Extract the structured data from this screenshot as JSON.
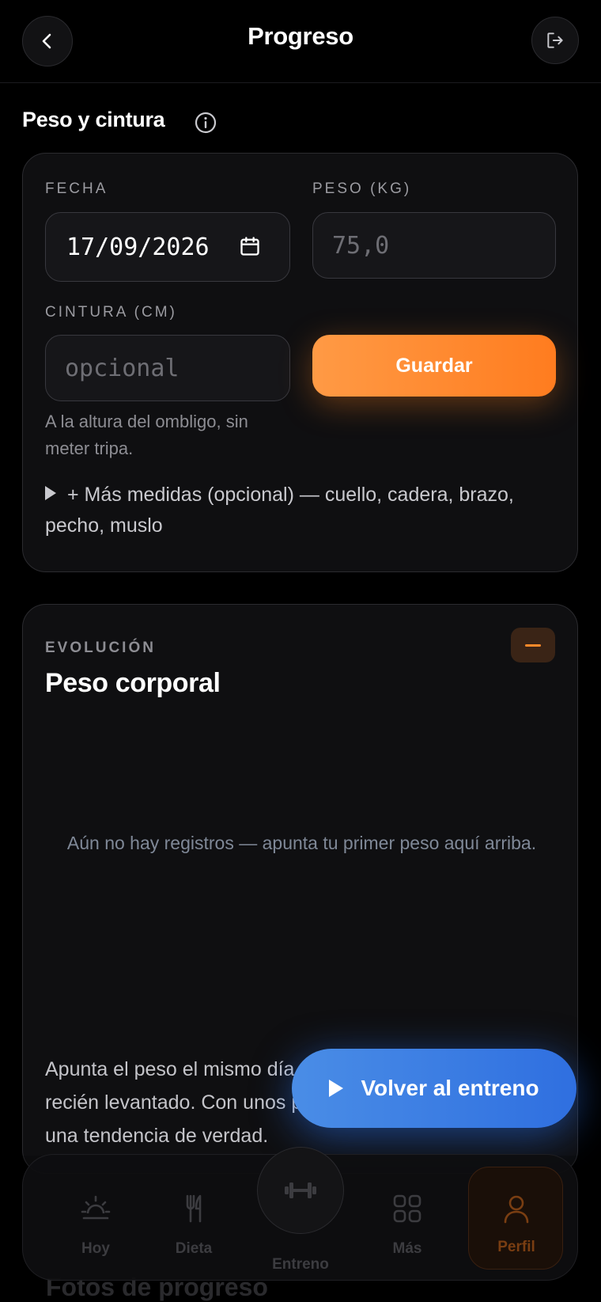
{
  "header": {
    "title": "Progreso",
    "back_icon": "chevron-left-icon",
    "logout_icon": "logout-icon"
  },
  "section": {
    "title": "Peso y cintura",
    "info_icon": "info-icon"
  },
  "form": {
    "fecha_label": "FECHA",
    "fecha_value": "17/09/2026",
    "peso_label": "PESO (KG)",
    "peso_placeholder": "75,0",
    "cintura_label": "CINTURA (CM)",
    "cintura_placeholder": "opcional",
    "save_label": "Guardar",
    "cintura_hint": "A la altura del ombligo, sin meter tripa.",
    "more_measures": "+ Más medidas (opcional) — cuello, cadera, brazo, pecho, muslo"
  },
  "evolution": {
    "eyebrow": "EVOLUCIÓN",
    "title": "Peso corporal",
    "empty_text": "Aún no hay registros — apunta tu primer peso aquí arriba.",
    "tip": "Apunta el peso el mismo día de la semana, en ayunas y recién levantado. Con unos pocos registros ya vas a ver una tendencia de verdad."
  },
  "fab": {
    "label": "Volver al entreno"
  },
  "photos": {
    "title": "Fotos de progreso"
  },
  "nav": {
    "items": [
      {
        "label": "Hoy",
        "icon": "sunrise-icon"
      },
      {
        "label": "Dieta",
        "icon": "utensils-icon"
      },
      {
        "label": "Entreno",
        "icon": "dumbbell-icon"
      },
      {
        "label": "Más",
        "icon": "grid-icon"
      },
      {
        "label": "Perfil",
        "icon": "user-icon"
      }
    ],
    "active": "Perfil"
  },
  "colors": {
    "accent": "#FF8A2A",
    "cta_blue": "#3A7BE3",
    "background": "#000000",
    "card": "#0F0F11"
  }
}
